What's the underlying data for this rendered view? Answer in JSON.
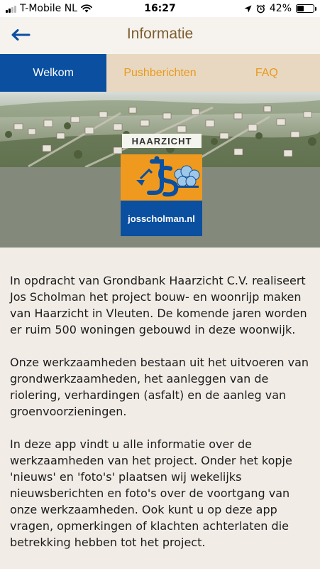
{
  "status_bar": {
    "carrier": "T-Mobile NL",
    "time": "16:27",
    "battery": "42%",
    "battery_level": 0.42
  },
  "header": {
    "title": "Informatie"
  },
  "tabs": [
    {
      "label": "Welkom",
      "active": true
    },
    {
      "label": "Pushberichten",
      "active": false
    },
    {
      "label": "FAQ",
      "active": false
    }
  ],
  "hero": {
    "sign_text": "HAARZICHT",
    "logo_text": "josscholman.nl"
  },
  "content": {
    "paragraphs": [
      "In opdracht van Grondbank Haarzicht C.V. realiseert Jos Scholman het project bouw- en woonrijp maken van Haarzicht in Vleuten. De komende jaren worden er ruim 500 woningen gebouwd in deze woonwijk.",
      "Onze werkzaamheden bestaan uit het uitvoeren van grondwerkzaamheden, het aanleggen van de riolering, verhardingen (asfalt) en de aanleg van groenvoorzieningen.",
      "In deze app vindt u alle informatie over de werkzaamheden van het project. Onder het kopje 'nieuws' en 'foto's' plaatsen wij wekelijks nieuwsberichten en foto's over de voortgang van onze werkzaamheden. Ook kunt u op deze app vragen, opmerkingen of klachten achterlaten die betrekking hebben tot het project."
    ]
  },
  "colors": {
    "brand_blue": "#0a4fa0",
    "brand_orange": "#ef9a1e",
    "title_brown": "#7c5d2f"
  }
}
